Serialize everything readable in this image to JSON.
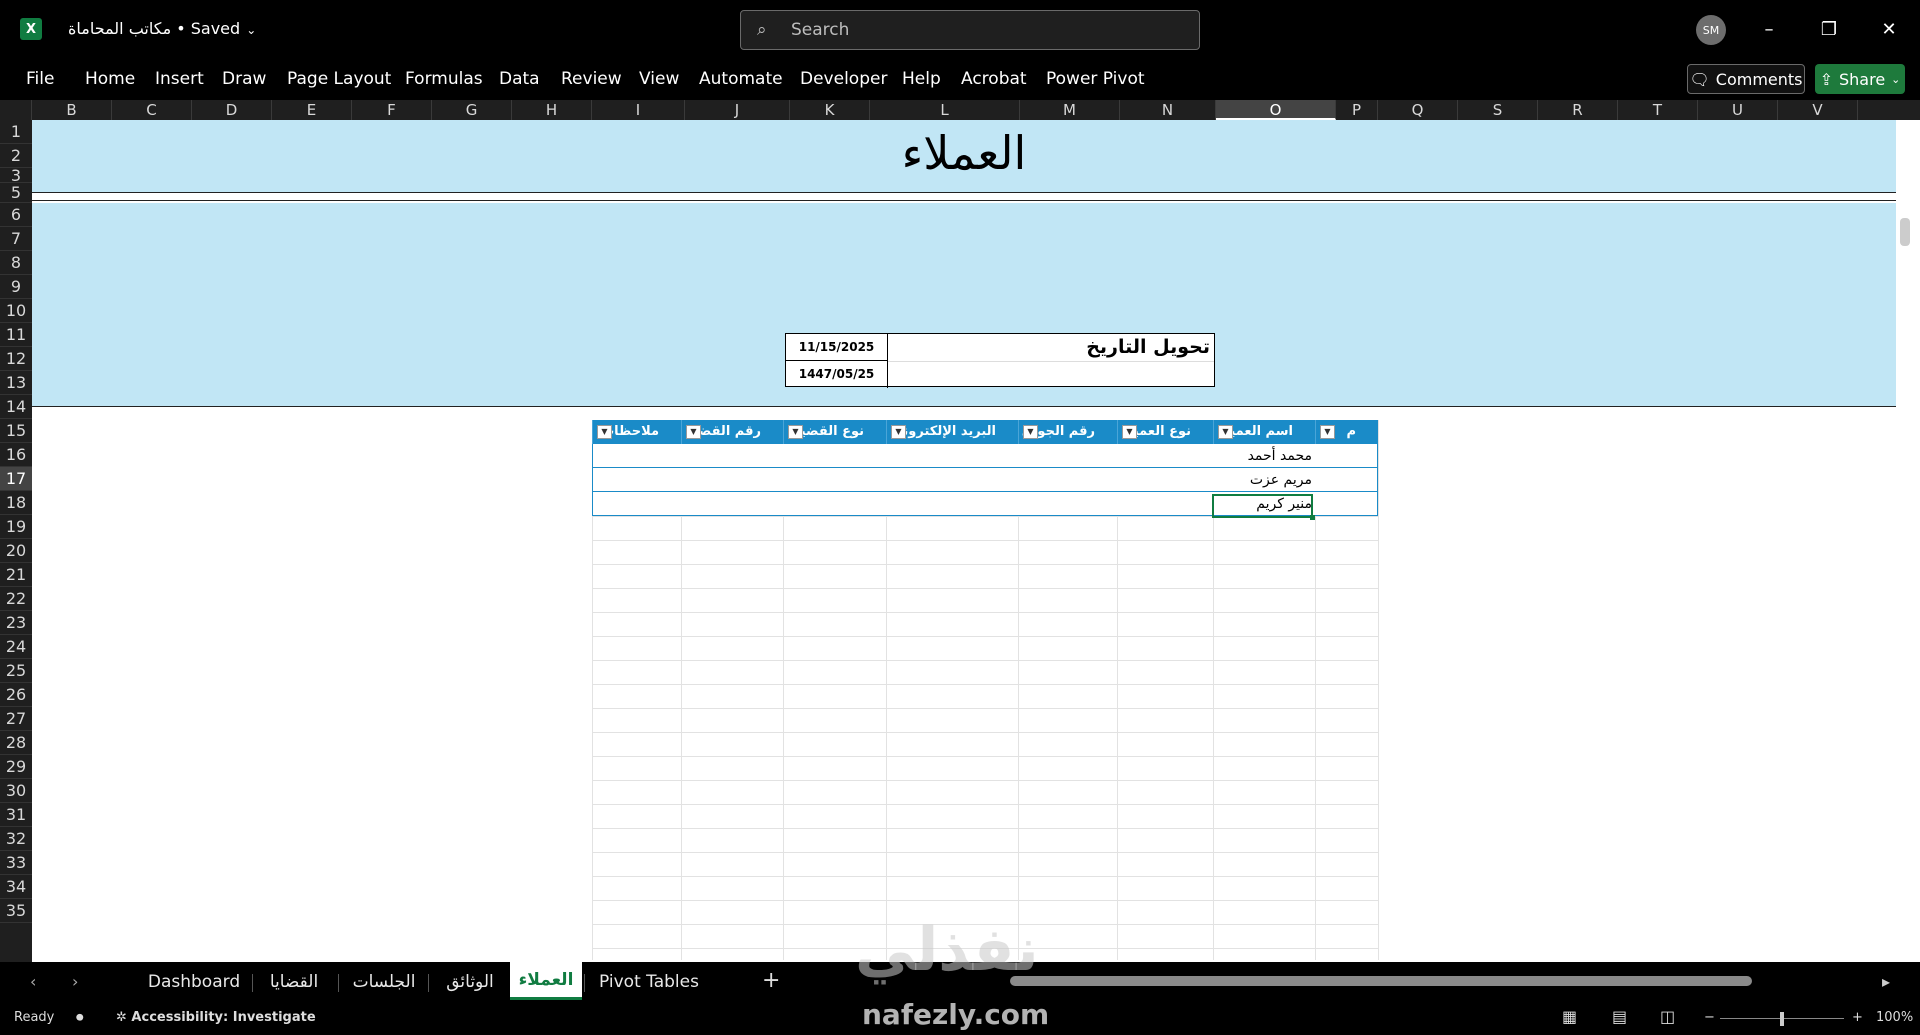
{
  "titlebar": {
    "logo": "X",
    "doc_title": "مكاتب المحاماة • Saved",
    "search_placeholder": "Search",
    "avatar": "SM",
    "minimize": "–",
    "restore": "❐",
    "close": "✕"
  },
  "ribbon": {
    "tabs": [
      "File",
      "Home",
      "Insert",
      "Draw",
      "Page Layout",
      "Formulas",
      "Data",
      "Review",
      "View",
      "Automate",
      "Developer",
      "Help",
      "Acrobat",
      "Power Pivot"
    ],
    "comments_label": "Comments",
    "share_label": "Share"
  },
  "columns": [
    "B",
    "C",
    "D",
    "E",
    "F",
    "G",
    "H",
    "I",
    "J",
    "K",
    "L",
    "M",
    "N",
    "O",
    "P",
    "Q",
    "S",
    "R",
    "T",
    "U",
    "V"
  ],
  "rows": [
    "1",
    "2",
    "3",
    "5",
    "6",
    "7",
    "8",
    "9",
    "10",
    "11",
    "12",
    "13",
    "14",
    "15",
    "16",
    "17",
    "18",
    "19",
    "20",
    "21",
    "22",
    "23",
    "24",
    "25",
    "26",
    "27",
    "28",
    "29",
    "30",
    "31",
    "32",
    "33",
    "34",
    "35"
  ],
  "sheet": {
    "title": "العملاء",
    "date_label": "تحويل التاريخ",
    "gregorian_date": "11/15/2025",
    "hijri_date": "1447/05/25"
  },
  "table": {
    "headers": [
      "م",
      "اسم العميل",
      "نوع العميل",
      "رقم الجوال",
      "البريد الإلكتروني",
      "نوع القضية",
      "رقم القضية",
      "ملاحظات"
    ],
    "rows": [
      [
        "",
        "محمد أحمد",
        "",
        "",
        "",
        "",
        "",
        ""
      ],
      [
        "",
        "مريم عزت",
        "",
        "",
        "",
        "",
        "",
        ""
      ],
      [
        "",
        "منير كريم",
        "",
        "",
        "",
        "",
        "",
        ""
      ]
    ]
  },
  "sheet_tabs": [
    "Dashboard",
    "القضايا",
    "الجلسات",
    "الوثائق",
    "العملاء",
    "Pivot Tables"
  ],
  "active_sheet": "العملاء",
  "status": {
    "ready": "Ready",
    "accessibility": "Accessibility: Investigate",
    "zoom": "100%"
  },
  "watermark": {
    "arabic": "نفذلي",
    "latin": "nafezly.com"
  },
  "colors": {
    "band": "#c1e6f5",
    "table_header": "#1a8bc8",
    "excel_green": "#107c41"
  }
}
